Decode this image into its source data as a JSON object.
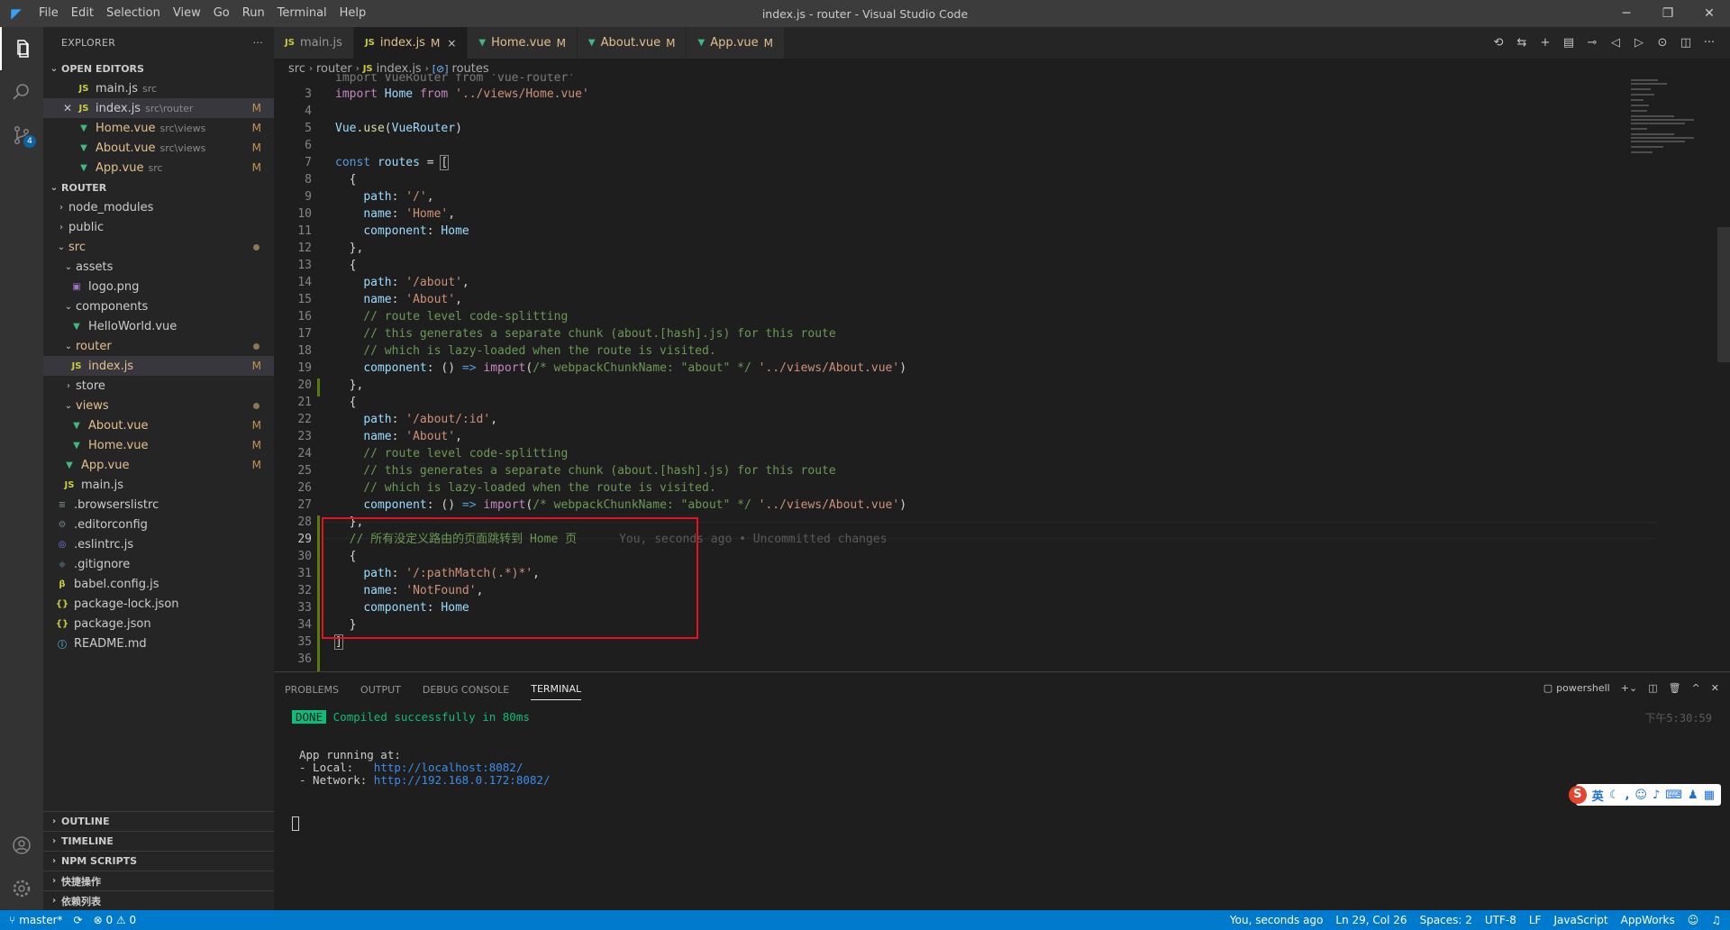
{
  "titlebar": {
    "menu": [
      "File",
      "Edit",
      "Selection",
      "View",
      "Go",
      "Run",
      "Terminal",
      "Help"
    ],
    "title": "index.js - router - Visual Studio Code"
  },
  "activity": {
    "scm_badge": "4"
  },
  "explorer": {
    "title": "EXPLORER",
    "open_editors_title": "OPEN EDITORS",
    "open_editors": [
      {
        "name": "main.js",
        "desc": "src",
        "icon": "JS",
        "status": ""
      },
      {
        "name": "index.js",
        "desc": "src\\router",
        "icon": "JS",
        "status": "M"
      },
      {
        "name": "Home.vue",
        "desc": "src\\views",
        "icon": "V",
        "status": "M"
      },
      {
        "name": "About.vue",
        "desc": "src\\views",
        "icon": "V",
        "status": "M"
      },
      {
        "name": "App.vue",
        "desc": "src",
        "icon": "V",
        "status": "M"
      }
    ],
    "root_title": "ROUTER",
    "tree": [
      {
        "name": "node_modules"
      },
      {
        "name": "public"
      },
      {
        "name": "src"
      },
      {
        "name": "assets"
      },
      {
        "name": "logo.png"
      },
      {
        "name": "components"
      },
      {
        "name": "HelloWorld.vue"
      },
      {
        "name": "router"
      },
      {
        "name": "index.js",
        "status": "M"
      },
      {
        "name": "store"
      },
      {
        "name": "views"
      },
      {
        "name": "About.vue",
        "status": "M"
      },
      {
        "name": "Home.vue",
        "status": "M"
      },
      {
        "name": "App.vue",
        "status": "M"
      },
      {
        "name": "main.js"
      },
      {
        "name": ".browserslistrc"
      },
      {
        "name": ".editorconfig"
      },
      {
        "name": ".eslintrc.js"
      },
      {
        "name": ".gitignore"
      },
      {
        "name": "babel.config.js"
      },
      {
        "name": "package-lock.json"
      },
      {
        "name": "package.json"
      },
      {
        "name": "README.md"
      }
    ],
    "bottom_sections": [
      "OUTLINE",
      "TIMELINE",
      "NPM SCRIPTS",
      "快捷操作",
      "依赖列表"
    ]
  },
  "tabs": [
    {
      "name": "main.js",
      "icon": "JS"
    },
    {
      "name": "index.js",
      "icon": "JS",
      "status": "M",
      "close": "×"
    },
    {
      "name": "Home.vue",
      "icon": "V",
      "status": "M"
    },
    {
      "name": "About.vue",
      "icon": "V",
      "status": "M"
    },
    {
      "name": "App.vue",
      "icon": "V",
      "status": "M"
    }
  ],
  "breadcrumb": {
    "p1": "src",
    "p2": "router",
    "file": "index.js",
    "symbol": "routes"
  },
  "editor": {
    "cut_line": "import VueRouter from 'vue-router'",
    "line_numbers": [
      "3",
      "4",
      "5",
      "6",
      "7",
      "8",
      "9",
      "10",
      "11",
      "12",
      "13",
      "14",
      "15",
      "16",
      "17",
      "18",
      "19",
      "20",
      "21",
      "22",
      "23",
      "24",
      "25",
      "26",
      "27",
      "28",
      "29",
      "30",
      "31",
      "32",
      "33",
      "34",
      "35",
      "36"
    ],
    "blame": "You, seconds ago • Uncommitted changes"
  },
  "panel": {
    "tabs": [
      "PROBLEMS",
      "OUTPUT",
      "DEBUG CONSOLE",
      "TERMINAL"
    ],
    "shell": "powershell",
    "done_label": "DONE",
    "compiled": "Compiled successfully in 80ms",
    "time": "下午5:30:59",
    "app_running": "App running at:",
    "local_label": "- Local:   ",
    "local_url": "http://localhost:8082/",
    "network_label": "- Network: ",
    "network_url": "http://192.168.0.172:8082/",
    "ime_lang": "英"
  },
  "statusbar": {
    "branch": "master*",
    "problems": "⊗ 0 ⚠ 0",
    "blame": "You, seconds ago",
    "position": "Ln 29, Col 26",
    "spaces": "Spaces: 2",
    "encoding": "UTF-8",
    "eol": "LF",
    "language": "JavaScript",
    "appworks": "AppWorks"
  }
}
